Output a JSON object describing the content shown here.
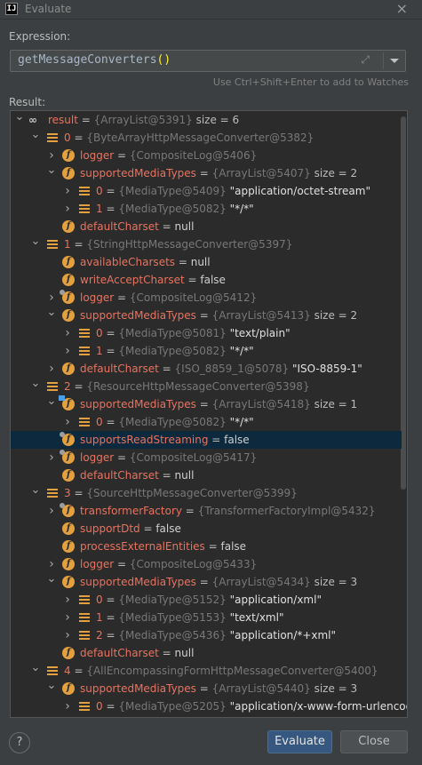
{
  "window": {
    "title": "Evaluate",
    "app_icon": "IJ"
  },
  "expression": {
    "label": "Expression:",
    "value_text": "getMessageConverters",
    "value_parens": "()",
    "hint": "Use Ctrl+Shift+Enter to add to Watches"
  },
  "result": {
    "label": "Result:",
    "rows": [
      {
        "depth": 0,
        "chev": "down",
        "icon": "glasses",
        "name": "result",
        "ref": "{ArrayList@5391}",
        "extra": "size = 6"
      },
      {
        "depth": 1,
        "chev": "down",
        "icon": "list",
        "name": "0",
        "ref": "{ByteArrayHttpMessageConverter@5382}"
      },
      {
        "depth": 2,
        "chev": "right",
        "icon": "f",
        "name": "logger",
        "ref": "{CompositeLog@5406}"
      },
      {
        "depth": 2,
        "chev": "down",
        "icon": "f",
        "name": "supportedMediaTypes",
        "ref": "{ArrayList@5407}",
        "extra": "size = 2"
      },
      {
        "depth": 3,
        "chev": "right",
        "icon": "list",
        "name": "0",
        "ref": "{MediaType@5409}",
        "value": "\"application/octet-stream\""
      },
      {
        "depth": 3,
        "chev": "right",
        "icon": "list",
        "name": "1",
        "ref": "{MediaType@5082}",
        "value": "\"*/*\""
      },
      {
        "depth": 2,
        "chev": "",
        "icon": "f",
        "name": "defaultCharset",
        "value": "null"
      },
      {
        "depth": 1,
        "chev": "down",
        "icon": "list",
        "name": "1",
        "ref": "{StringHttpMessageConverter@5397}"
      },
      {
        "depth": 2,
        "chev": "",
        "icon": "f",
        "name": "availableCharsets",
        "value": "null"
      },
      {
        "depth": 2,
        "chev": "",
        "icon": "f",
        "name": "writeAcceptCharset",
        "value": "false"
      },
      {
        "depth": 2,
        "chev": "right",
        "icon": "f-lock",
        "name": "logger",
        "ref": "{CompositeLog@5412}"
      },
      {
        "depth": 2,
        "chev": "down",
        "icon": "f",
        "name": "supportedMediaTypes",
        "ref": "{ArrayList@5413}",
        "extra": "size = 2"
      },
      {
        "depth": 3,
        "chev": "right",
        "icon": "list",
        "name": "0",
        "ref": "{MediaType@5081}",
        "value": "\"text/plain\""
      },
      {
        "depth": 3,
        "chev": "right",
        "icon": "list",
        "name": "1",
        "ref": "{MediaType@5082}",
        "value": "\"*/*\""
      },
      {
        "depth": 2,
        "chev": "right",
        "icon": "f",
        "name": "defaultCharset",
        "ref": "{ISO_8859_1@5078}",
        "value": "\"ISO-8859-1\""
      },
      {
        "depth": 1,
        "chev": "down",
        "icon": "list",
        "name": "2",
        "ref": "{ResourceHttpMessageConverter@5398}"
      },
      {
        "depth": 2,
        "chev": "down",
        "icon": "f-flag",
        "name": "supportedMediaTypes",
        "ref": "{ArrayList@5418}",
        "extra": "size = 1"
      },
      {
        "depth": 3,
        "chev": "right",
        "icon": "list",
        "name": "0",
        "ref": "{MediaType@5082}",
        "value": "\"*/*\""
      },
      {
        "depth": 2,
        "chev": "",
        "icon": "f-lock",
        "name": "supportsReadStreaming",
        "value": "false",
        "selected": true
      },
      {
        "depth": 2,
        "chev": "right",
        "icon": "f-lock",
        "name": "logger",
        "ref": "{CompositeLog@5417}"
      },
      {
        "depth": 2,
        "chev": "",
        "icon": "f",
        "name": "defaultCharset",
        "value": "null"
      },
      {
        "depth": 1,
        "chev": "down",
        "icon": "list",
        "name": "3",
        "ref": "{SourceHttpMessageConverter@5399}"
      },
      {
        "depth": 2,
        "chev": "right",
        "icon": "f-lock",
        "name": "transformerFactory",
        "ref": "{TransformerFactoryImpl@5432}"
      },
      {
        "depth": 2,
        "chev": "",
        "icon": "f",
        "name": "supportDtd",
        "value": "false"
      },
      {
        "depth": 2,
        "chev": "",
        "icon": "f",
        "name": "processExternalEntities",
        "value": "false"
      },
      {
        "depth": 2,
        "chev": "right",
        "icon": "f",
        "name": "logger",
        "ref": "{CompositeLog@5433}"
      },
      {
        "depth": 2,
        "chev": "down",
        "icon": "f",
        "name": "supportedMediaTypes",
        "ref": "{ArrayList@5434}",
        "extra": "size = 3"
      },
      {
        "depth": 3,
        "chev": "right",
        "icon": "list",
        "name": "0",
        "ref": "{MediaType@5152}",
        "value": "\"application/xml\""
      },
      {
        "depth": 3,
        "chev": "right",
        "icon": "list",
        "name": "1",
        "ref": "{MediaType@5153}",
        "value": "\"text/xml\""
      },
      {
        "depth": 3,
        "chev": "right",
        "icon": "list",
        "name": "2",
        "ref": "{MediaType@5436}",
        "value": "\"application/*+xml\""
      },
      {
        "depth": 2,
        "chev": "",
        "icon": "f",
        "name": "defaultCharset",
        "value": "null"
      },
      {
        "depth": 1,
        "chev": "down",
        "icon": "list",
        "name": "4",
        "ref": "{AllEncompassingFormHttpMessageConverter@5400}"
      },
      {
        "depth": 2,
        "chev": "down",
        "icon": "f",
        "name": "supportedMediaTypes",
        "ref": "{ArrayList@5440}",
        "extra": "size = 3"
      },
      {
        "depth": 3,
        "chev": "right",
        "icon": "list",
        "name": "0",
        "ref": "{MediaType@5205}",
        "value": "\"application/x-www-form-urlencoded"
      }
    ]
  },
  "buttons": {
    "help": "?",
    "evaluate": "Evaluate",
    "close": "Close"
  }
}
